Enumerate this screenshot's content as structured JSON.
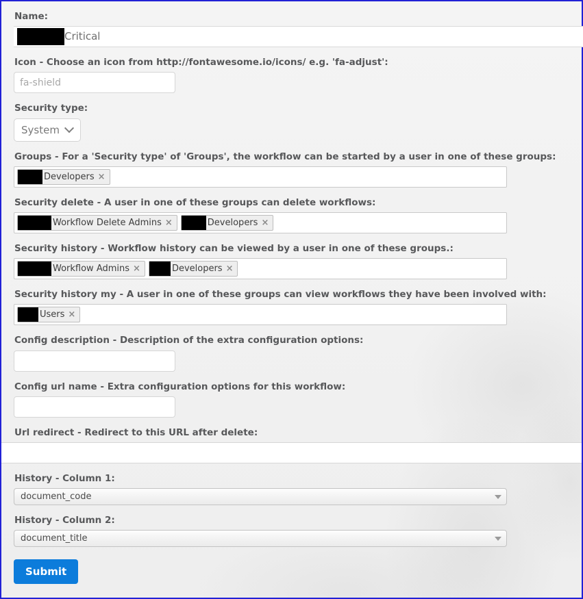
{
  "theme": {
    "page_border_color": "#2121d6",
    "label_color": "#57585a",
    "submit_color": "#0c7cdb",
    "background_color": "#f2f2f2"
  },
  "form": {
    "fields": [
      {
        "key": "name",
        "label": "Name:",
        "type": "text-redacted",
        "value": "Critical",
        "redacted": true
      },
      {
        "key": "icon",
        "label": "Icon - Choose an icon from http://fontawesome.io/icons/ e.g. 'fa-adjust':",
        "type": "text",
        "value": "",
        "placeholder": "fa-shield"
      },
      {
        "key": "security_type",
        "label": "Security type:",
        "type": "select",
        "value": "System",
        "options": [
          "System"
        ]
      },
      {
        "key": "groups",
        "label": "Groups - For a 'Security type' of 'Groups', the workflow can be started by a user in one of these groups:",
        "type": "tags",
        "tags": [
          {
            "label": "Developers",
            "redact_width": 36,
            "remove_label": "×"
          }
        ]
      },
      {
        "key": "security_delete",
        "label": "Security delete - A user in one of these groups can delete workflows:",
        "type": "tags",
        "tags": [
          {
            "label": "Workflow Delete Admins",
            "redact_width": 49,
            "remove_label": "×"
          },
          {
            "label": "Developers",
            "redact_width": 36,
            "remove_label": "×"
          }
        ]
      },
      {
        "key": "security_history",
        "label": "Security history - Workflow history can be viewed by a user in one of these groups.:",
        "type": "tags",
        "tags": [
          {
            "label": "Workflow Admins",
            "redact_width": 49,
            "remove_label": "×"
          },
          {
            "label": "Developers",
            "redact_width": 31,
            "remove_label": "×"
          }
        ]
      },
      {
        "key": "security_history_my",
        "label": "Security history my - A user in one of these groups can view workflows they have been involved with:",
        "type": "tags",
        "tags": [
          {
            "label": "Users",
            "redact_width": 30,
            "remove_label": "×"
          }
        ]
      },
      {
        "key": "config_description",
        "label": "Config description - Description of the extra configuration options:",
        "type": "text",
        "value": "",
        "placeholder": ""
      },
      {
        "key": "config_url_name",
        "label": "Config url name - Extra configuration options for this workflow:",
        "type": "text",
        "value": "",
        "placeholder": ""
      },
      {
        "key": "url_redirect",
        "label": "Url redirect - Redirect to this URL after delete:",
        "type": "text-wide",
        "value": "",
        "placeholder": ""
      },
      {
        "key": "history_column_1",
        "label": "History - Column 1:",
        "type": "select-wide",
        "value": "document_code",
        "options": [
          "document_code"
        ]
      },
      {
        "key": "history_column_2",
        "label": "History - Column 2:",
        "type": "select-wide",
        "value": "document_title",
        "options": [
          "document_title"
        ]
      }
    ],
    "submit_label": "Submit"
  }
}
